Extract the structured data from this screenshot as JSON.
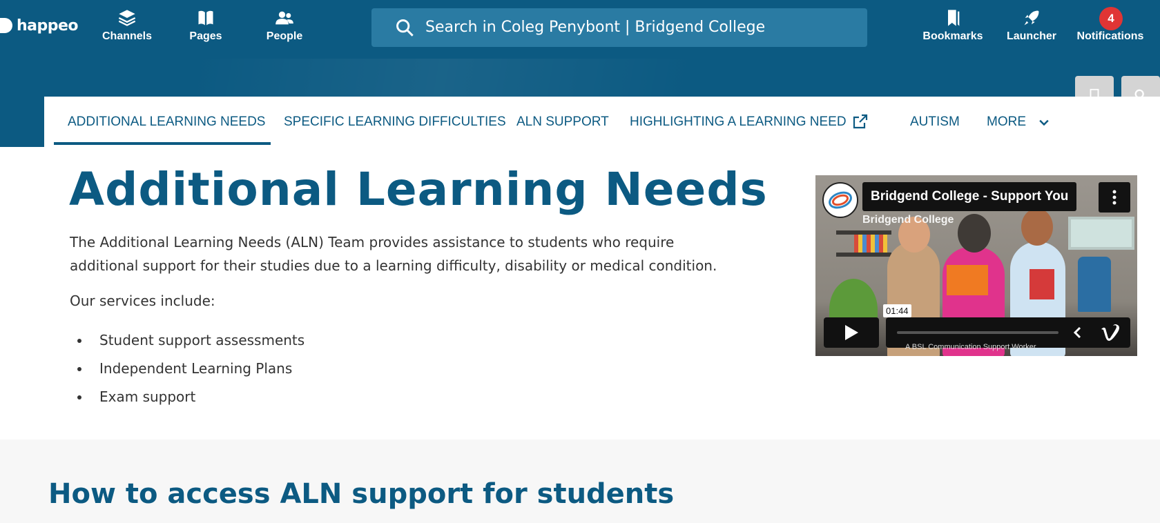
{
  "topbar": {
    "brand": "happeo",
    "nav": [
      {
        "label": "Channels",
        "icon": "layers-icon"
      },
      {
        "label": "Pages",
        "icon": "book-icon"
      },
      {
        "label": "People",
        "icon": "people-icon"
      }
    ],
    "search_placeholder": "Search in Coleg Penybont | Bridgend College",
    "right": [
      {
        "label": "Bookmarks",
        "icon": "bookmarks-icon"
      },
      {
        "label": "Launcher",
        "icon": "rocket-icon"
      },
      {
        "label": "Notifications",
        "icon": "notification-badge",
        "count": "4"
      }
    ]
  },
  "tabs": [
    {
      "label": "ADDITIONAL LEARNING NEEDS",
      "active": true
    },
    {
      "label": "SPECIFIC LEARNING DIFFICULTIES",
      "active": false
    },
    {
      "label": "ALN SUPPORT",
      "active": false
    },
    {
      "label": "HIGHLIGHTING A LEARNING NEED",
      "active": false,
      "external": true
    },
    {
      "label": "AUTISM",
      "active": false
    },
    {
      "label": "MORE",
      "active": false,
      "dropdown": true
    }
  ],
  "main": {
    "title": "Additional Learning Needs",
    "intro": "The Additional Learning Needs (ALN) Team provides assistance to students who require additional support for their studies due to a learning difficulty, disability or medical condition.",
    "services_label": "Our services include:",
    "services": [
      "Student support assessments",
      "Independent Learning Plans",
      "Exam support"
    ]
  },
  "video": {
    "title": "Bridgend College - Support You",
    "channel": "Bridgend College",
    "timestamp": "01:44",
    "caption": "A BSL Communication Support Worker"
  },
  "section": {
    "heading": "How to access ALN support for students"
  },
  "colors": {
    "primary": "#0c5a82",
    "search_bg": "#2a7ba3",
    "badge": "#e03535"
  }
}
